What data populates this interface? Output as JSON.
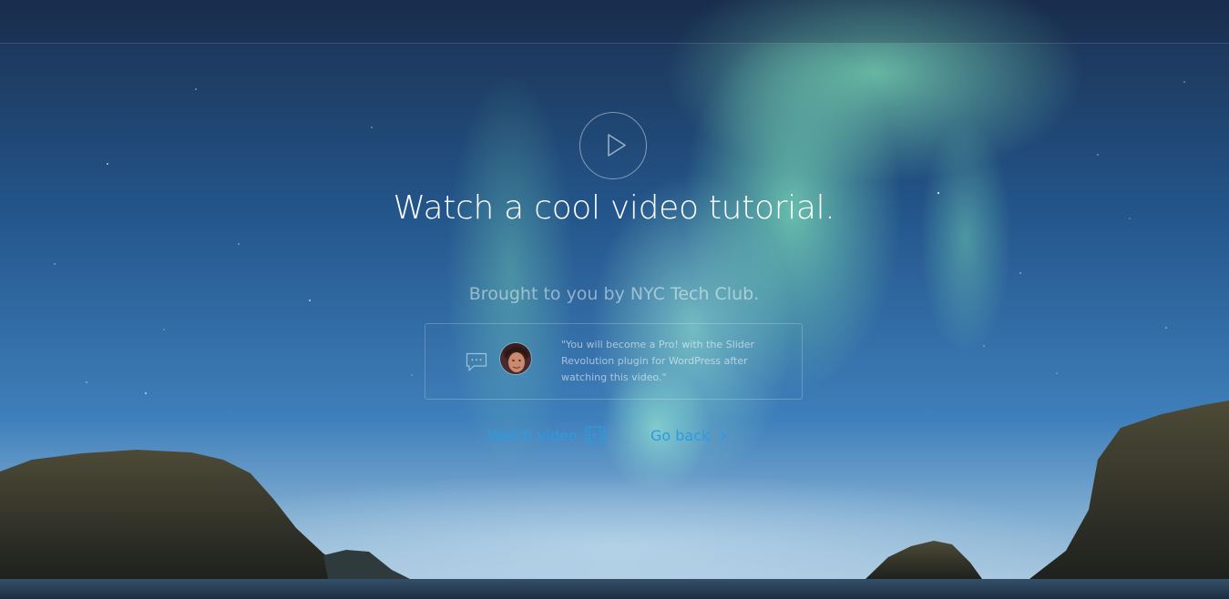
{
  "hero": {
    "headline": "Watch a cool video tutorial.",
    "subtitle": "Brought to you by NYC Tech Club."
  },
  "testimonial": {
    "quote": "\"You will become a Pro! with the Slider Revolution plugin for WordPress after watching this video.\""
  },
  "actions": {
    "watch_label": "Watch video",
    "back_label": "Go back"
  },
  "colors": {
    "link": "#2b9be0",
    "text": "#ffffff"
  },
  "icons": {
    "play": "play-icon",
    "chat": "chat-bubble-icon",
    "video": "film-icon",
    "back": "chevron-right-icon"
  }
}
